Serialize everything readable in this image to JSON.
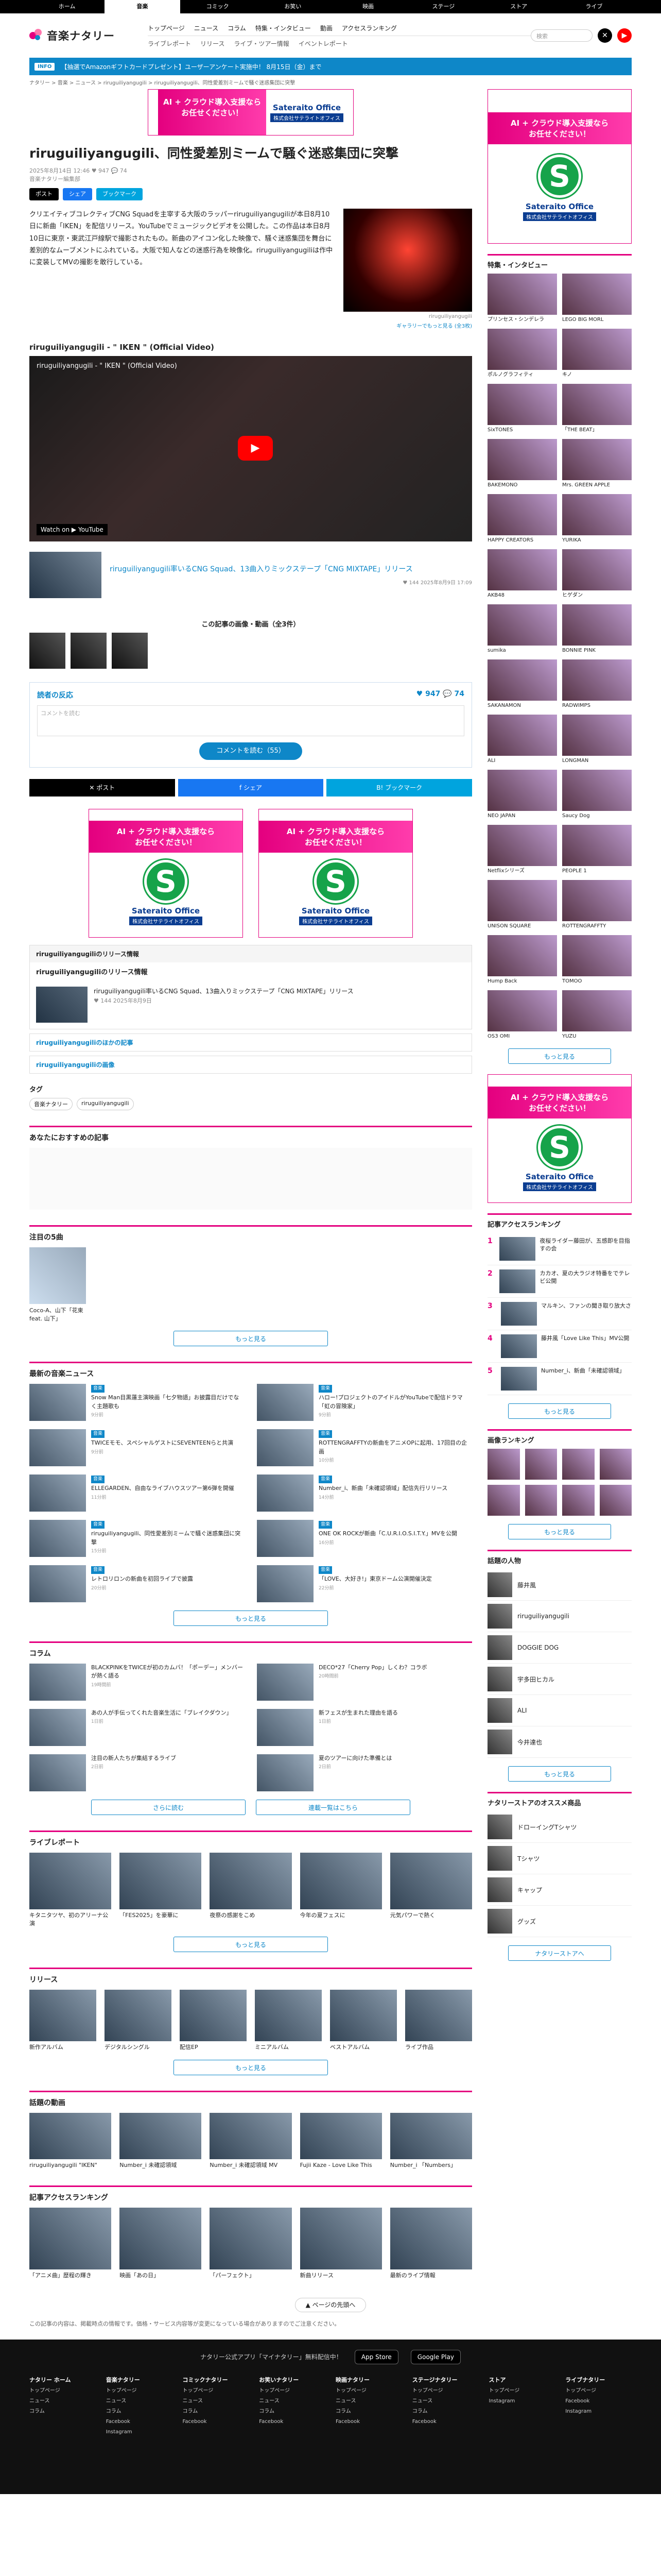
{
  "topnav": [
    "ホーム",
    "音楽",
    "コミック",
    "お笑い",
    "映画",
    "ステージ",
    "ストア",
    "ライブ"
  ],
  "brand": {
    "name": "音楽ナタリー",
    "accent": "#e4007f",
    "sub": "#0e87c8"
  },
  "nav": {
    "r1": [
      "トップページ",
      "ニュース",
      "コラム",
      "特集・インタビュー",
      "動画",
      "アクセスランキング"
    ],
    "r2": [
      "ライブレポート",
      "リリース",
      "ライブ・ツアー情報",
      "イベントレポート"
    ]
  },
  "search_placeholder": "検索",
  "info": {
    "badge": "INFO",
    "text": "【抽選でAmazonギフトカードプレゼント】ユーザーアンケート実施中！ 8月15日（金）まで"
  },
  "breadcrumb": "ナタリー > 音楽 > ニュース > riruguiliyangugili > riruguiliyangugili、同性愛差別ミームで騒ぐ迷惑集団に突撃",
  "ad": {
    "line1": "AI + クラウド導入支援なら",
    "line2": "お任せください！",
    "name": "Sateraito Office",
    "co": "株式会社サテライトオフィス",
    "s": "S"
  },
  "article": {
    "title": "riruguiliyangugili、同性愛差別ミームで騒ぐ迷惑集団に突撃",
    "date": "2025年8月14日 12:46",
    "counts": "♥ 947  💬 74",
    "author": "音楽ナタリー編集部",
    "body": "クリエイティブコレクティブCNG Squadを主宰する大阪のラッパーriruguiliyangugiliが本日8月10日に新曲「IKEN」を配信リリース。YouTubeでミュージックビデオを公開した。この作品は本日8月10日に東京・東武江戸線駅で撮影されたもの。新曲のアイコン化した映像で、騒ぐ迷惑集団を舞台に差別的なムーブメントにふれている。大阪で知人などの迷惑行為を映像化。riruguiliyangugiliは作中に変装してMVの撮影を敢行している。",
    "photo_caption": "riruguiliyangugili",
    "photo_more": "ギャラリーでもっと見る (全3枚)"
  },
  "share": {
    "x": "ポスト",
    "fb": "シェア",
    "hb": "ブックマーク"
  },
  "video": {
    "section": "riruguiliyangugili - \" IKEN \" (Official Video)",
    "title": "riruguiliyangugili - \" IKEN \" (Official Video)",
    "watch": "Watch on ▶ YouTube"
  },
  "related": {
    "text": "riruguiliyangugili率いるCNG Squad、13曲入りミックステープ「CNG MIXTAPE」リリース",
    "time": "♥ 144  2025年8月9日 17:09"
  },
  "gallery": {
    "title": "この記事の画像・動画（全3件）"
  },
  "reactions": {
    "title": "読者の反応",
    "counts": "♥ 947  💬 74",
    "placeholder": "コメントを読む",
    "button": "コメントを読む（55）"
  },
  "sharebar": [
    "✕ ポスト",
    "f シェア",
    "B! ブックマーク"
  ],
  "release_box": {
    "head": "riruguiliyangugiliのリリース情報",
    "label": "riruguiliyangugiliのリリース情報",
    "text": "riruguiliyangugili率いるCNG Squad、13曲入りミックステープ「CNG MIXTAPE」リリース",
    "time": "♥ 144  2025年8月9日"
  },
  "links": [
    "riruguiliyangugiliのほかの記事",
    "riruguiliyangugiliの画像"
  ],
  "tags": {
    "title": "タグ",
    "items": [
      "音楽ナタリー",
      "riruguiliyangugili"
    ]
  },
  "recommend": {
    "title": "あなたにおすすめの記事"
  },
  "pickup": {
    "title": "注目の5曲",
    "caption": "Coco-A、山下「花束 feat. 山下」",
    "more": "もっと見る"
  },
  "latest": {
    "title": "最新の音楽ニュース",
    "more": "もっと見る",
    "items": [
      {
        "cat": "音楽",
        "text": "Snow Man目黒蓮主演映画「七夕物語」お披露目だけでなく主題歌も",
        "date": "9分前"
      },
      {
        "cat": "音楽",
        "text": "ハロー!プロジェクトのアイドルがYouTubeで配信ドラマ「虹の冒険家」",
        "date": "9分前"
      },
      {
        "cat": "音楽",
        "text": "TWICEモモ、スペシャルゲストにSEVENTEENらと共演",
        "date": "9分前"
      },
      {
        "cat": "音楽",
        "text": "ROTTENGRAFFTYの新曲をアニメOPに起用、17回目の企画",
        "date": "10分前"
      },
      {
        "cat": "音楽",
        "text": "ELLEGARDEN、自由なライブハウスツアー第6弾を開催",
        "date": "11分前"
      },
      {
        "cat": "音楽",
        "text": "Number_i、新曲「未確認領域」配信先行リリース",
        "date": "14分前"
      },
      {
        "cat": "音楽",
        "text": "riruguiliyangugili、同性愛差別ミームで騒ぐ迷惑集団に突撃",
        "date": "15分前"
      },
      {
        "cat": "音楽",
        "text": "ONE OK ROCKが新曲「C.U.R.I.O.S.I.T.Y.」MVを公開",
        "date": "16分前"
      },
      {
        "cat": "音楽",
        "text": "レトロリロンの新曲を初回ライブで披露",
        "date": "20分前"
      },
      {
        "cat": "音楽",
        "text": "「LOVE、大好き!」東京ドーム公演開催決定",
        "date": "22分前"
      }
    ]
  },
  "column": {
    "title": "コラム",
    "more": "さらに読む",
    "more2": "連載一覧はこちら",
    "items": [
      {
        "text": "BLACKPINKをTWICEが初のカムバ！「ポーデー」メンバーが熱く語る",
        "date": "19時間前"
      },
      {
        "text": "DECO*27「Cherry Pop」しくわ？コラボ",
        "date": "20時間前"
      },
      {
        "text": "あの人が手伝ってくれた音楽生活に「ブレイクダウン」",
        "date": "1日前"
      },
      {
        "text": "新フェスが生まれた理由を語る",
        "date": "1日前"
      },
      {
        "text": "注目の新人たちが集結するライブ",
        "date": "2日前"
      },
      {
        "text": "夏のツアーに向けた準備とは",
        "date": "2日前"
      }
    ]
  },
  "livereport": {
    "title": "ライブレポート",
    "more": "もっと見る",
    "items": [
      "キタニタツヤ、初のアリーナ公演",
      "「FES2025」を豪華に",
      "夜祭の感謝をこめ",
      "今年の夏フェスに",
      "元気パワーで熱く"
    ]
  },
  "release": {
    "title": "リリース",
    "more": "もっと見る",
    "items": [
      "新作アルバム",
      "デジタルシングル",
      "配信EP",
      "ミニアルバム",
      "ベストアルバム",
      "ライブ作品"
    ]
  },
  "videos": {
    "title": "話題の動画",
    "items": [
      "riruguiliyangugili \"IKEN\"",
      "Number_i 未確認領域",
      "Number_i 未確認領域 MV",
      "Fujii Kaze - Love Like This",
      "Number_i 「Numbers」"
    ]
  },
  "ranking": {
    "title": "記事アクセスランキング",
    "items": [
      "「アニメ曲」歴程の輝き",
      "映画「あの日」",
      "「パーフェクト」",
      "新曲リリース",
      "最新のライブ情報"
    ]
  },
  "side_interview": {
    "title": "特集・インタビュー",
    "more": "もっと見る",
    "items": [
      "プリンセス・シンデレラ",
      "LEGO BIG MORL",
      "ポルノグラフィティ",
      "キノ",
      "SixTONES",
      "「THE BEAT」",
      "BAKEMONO",
      "Mrs. GREEN APPLE",
      "HAPPY CREATORS",
      "YURIKA",
      "AKB48",
      "ヒゲダン",
      "sumika",
      "BONNIE PINK",
      "SAKANAMON",
      "RADWIMPS",
      "ALI",
      "LONGMAN",
      "NEO JAPAN",
      "Saucy Dog",
      "Netflixシリーズ",
      "PEOPLE 1",
      "UNISON SQUARE",
      "ROTTENGRAFFTY",
      "Hump Back",
      "TOMOO",
      "OS3 OMI",
      "YUZU"
    ]
  },
  "side_rank": {
    "title": "記事アクセスランキング",
    "items": [
      "夜桜ライダー藤田が、五感即を目指すの会",
      "カカオ、夏の大ラジオ特番をでテレビ公開",
      "マルキン、ファンの聞き取り放大さ",
      "藤井風「Love Like This」MV公開",
      "Number_i、新曲「未確認領域」"
    ],
    "more": "もっと見る"
  },
  "side_video": {
    "title": "画像ランキング",
    "more": "もっと見る"
  },
  "side_artists": {
    "title": "話題の人物",
    "items": [
      "藤井風",
      "riruguiliyangugili",
      "DOGGIE DOG",
      "宇多田ヒカル",
      "ALI",
      "今井達也"
    ],
    "more": "もっと見る"
  },
  "side_store": {
    "title": "ナタリーストアのオススメ商品",
    "items": [
      "ドローイングTシャツ",
      "Tシャツ",
      "キャップ",
      "グッズ"
    ],
    "more": "ナタリーストアへ"
  },
  "pagetop": "▲ ページの先頭へ",
  "footnote": "この記事の内容は、掲載時点の情報です。価格・サービス内容等が変更になっている場合がありますのでご注意ください。",
  "footer": {
    "app": "ナタリー公式アプリ「マイナタリー」無料配信中！",
    "apple": "App Store",
    "google": "Google Play",
    "cols": [
      {
        "h": "ナタリー ホーム",
        "i": [
          "トップページ",
          "ニュース",
          "コラム"
        ]
      },
      {
        "h": "音楽ナタリー",
        "i": [
          "トップページ",
          "ニュース",
          "コラム",
          "Facebook",
          "Instagram"
        ]
      },
      {
        "h": "コミックナタリー",
        "i": [
          "トップページ",
          "ニュース",
          "コラム",
          "Facebook"
        ]
      },
      {
        "h": "お笑いナタリー",
        "i": [
          "トップページ",
          "ニュース",
          "コラム",
          "Facebook"
        ]
      },
      {
        "h": "映画ナタリー",
        "i": [
          "トップページ",
          "ニュース",
          "コラム",
          "Facebook"
        ]
      },
      {
        "h": "ステージナタリー",
        "i": [
          "トップページ",
          "ニュース",
          "コラム",
          "Facebook"
        ]
      },
      {
        "h": "ストア",
        "i": [
          "トップページ",
          "Instagram"
        ]
      },
      {
        "h": "ライブナタリー",
        "i": [
          "トップページ",
          "Facebook",
          "Instagram"
        ]
      }
    ]
  }
}
